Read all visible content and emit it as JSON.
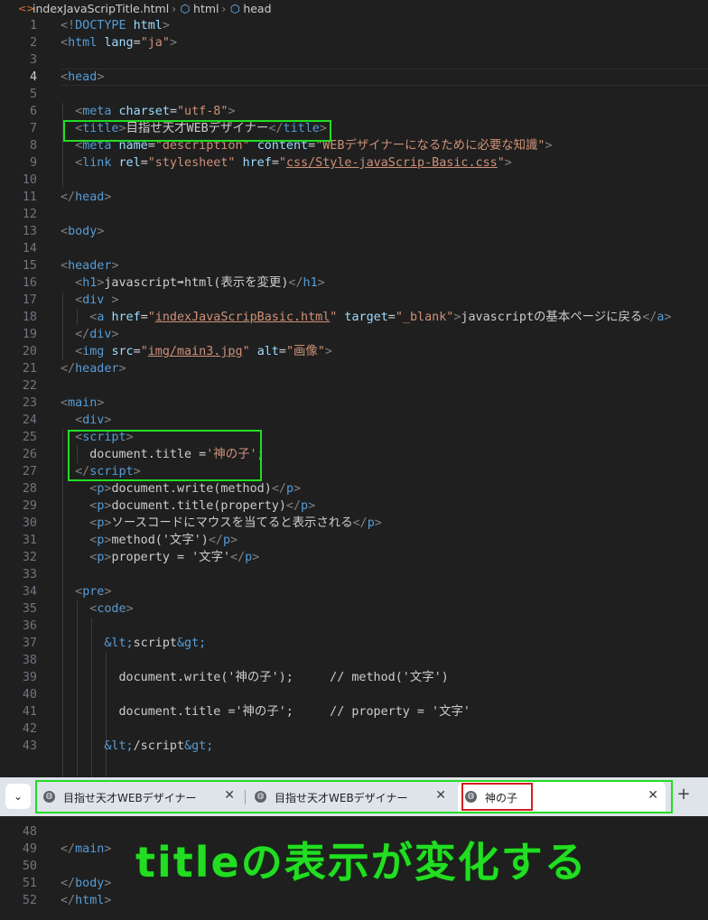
{
  "breadcrumb": {
    "items": [
      {
        "label": "indexJavaScripTitle.html",
        "icon": "html-file-icon"
      },
      {
        "label": "html",
        "icon": "element-cube-icon"
      },
      {
        "label": "head",
        "icon": "element-cube-icon"
      }
    ]
  },
  "editor": {
    "current_line": 4,
    "lines": [
      {
        "n": 1,
        "segs": [
          [
            "brk",
            "<!"
          ],
          [
            "tag",
            "DOCTYPE"
          ],
          [
            "txt",
            " "
          ],
          [
            "attr",
            "html"
          ],
          [
            "brk",
            ">"
          ]
        ]
      },
      {
        "n": 2,
        "segs": [
          [
            "brk",
            "<"
          ],
          [
            "tag",
            "html"
          ],
          [
            "txt",
            " "
          ],
          [
            "attr",
            "lang"
          ],
          [
            "txt",
            "="
          ],
          [
            "str",
            "\"ja\""
          ],
          [
            "brk",
            ">"
          ]
        ]
      },
      {
        "n": 3,
        "segs": []
      },
      {
        "n": 4,
        "segs": [
          [
            "brk",
            "<"
          ],
          [
            "tag",
            "head"
          ],
          [
            "brk",
            ">"
          ]
        ]
      },
      {
        "n": 5,
        "segs": []
      },
      {
        "n": 6,
        "segs": [
          [
            "txt",
            "  "
          ],
          [
            "brk",
            "<"
          ],
          [
            "tag",
            "meta"
          ],
          [
            "txt",
            " "
          ],
          [
            "attr",
            "charset"
          ],
          [
            "txt",
            "="
          ],
          [
            "str",
            "\"utf-8\""
          ],
          [
            "brk",
            ">"
          ]
        ]
      },
      {
        "n": 7,
        "segs": [
          [
            "txt",
            "  "
          ],
          [
            "brk",
            "<"
          ],
          [
            "tag",
            "title"
          ],
          [
            "brk",
            ">"
          ],
          [
            "txt",
            "目指せ天才WEBデザイナー"
          ],
          [
            "brk",
            "</"
          ],
          [
            "tag",
            "title"
          ],
          [
            "brk",
            ">"
          ]
        ]
      },
      {
        "n": 8,
        "segs": [
          [
            "txt",
            "  "
          ],
          [
            "brk",
            "<"
          ],
          [
            "tag",
            "meta"
          ],
          [
            "txt",
            " "
          ],
          [
            "attr",
            "name"
          ],
          [
            "txt",
            "="
          ],
          [
            "str",
            "\"description\""
          ],
          [
            "txt",
            " "
          ],
          [
            "attr",
            "content"
          ],
          [
            "txt",
            "="
          ],
          [
            "str",
            "\"WEBデザイナーになるために必要な知識\""
          ],
          [
            "brk",
            ">"
          ]
        ]
      },
      {
        "n": 9,
        "segs": [
          [
            "txt",
            "  "
          ],
          [
            "brk",
            "<"
          ],
          [
            "tag",
            "link"
          ],
          [
            "txt",
            " "
          ],
          [
            "attr",
            "rel"
          ],
          [
            "txt",
            "="
          ],
          [
            "str",
            "\"stylesheet\""
          ],
          [
            "txt",
            " "
          ],
          [
            "attr",
            "href"
          ],
          [
            "txt",
            "="
          ],
          [
            "str",
            "\""
          ],
          [
            "strul",
            "css/Style-javaScrip-Basic.css"
          ],
          [
            "str",
            "\""
          ],
          [
            "brk",
            ">"
          ]
        ]
      },
      {
        "n": 10,
        "segs": []
      },
      {
        "n": 11,
        "segs": [
          [
            "brk",
            "</"
          ],
          [
            "tag",
            "head"
          ],
          [
            "brk",
            ">"
          ]
        ]
      },
      {
        "n": 12,
        "segs": []
      },
      {
        "n": 13,
        "segs": [
          [
            "brk",
            "<"
          ],
          [
            "tag",
            "body"
          ],
          [
            "brk",
            ">"
          ]
        ]
      },
      {
        "n": 14,
        "segs": []
      },
      {
        "n": 15,
        "segs": [
          [
            "brk",
            "<"
          ],
          [
            "tag",
            "header"
          ],
          [
            "brk",
            ">"
          ]
        ]
      },
      {
        "n": 16,
        "segs": [
          [
            "txt",
            "  "
          ],
          [
            "brk",
            "<"
          ],
          [
            "tag",
            "h1"
          ],
          [
            "brk",
            ">"
          ],
          [
            "txt",
            "javascript➡html(表示を変更)"
          ],
          [
            "brk",
            "</"
          ],
          [
            "tag",
            "h1"
          ],
          [
            "brk",
            ">"
          ]
        ]
      },
      {
        "n": 17,
        "segs": [
          [
            "txt",
            "  "
          ],
          [
            "brk",
            "<"
          ],
          [
            "tag",
            "div"
          ],
          [
            "txt",
            " "
          ],
          [
            "brk",
            ">"
          ]
        ]
      },
      {
        "n": 18,
        "segs": [
          [
            "txt",
            "    "
          ],
          [
            "brk",
            "<"
          ],
          [
            "tag",
            "a"
          ],
          [
            "txt",
            " "
          ],
          [
            "attr",
            "href"
          ],
          [
            "txt",
            "="
          ],
          [
            "str",
            "\""
          ],
          [
            "strul",
            "indexJavaScripBasic.html"
          ],
          [
            "str",
            "\""
          ],
          [
            "txt",
            " "
          ],
          [
            "attr",
            "target"
          ],
          [
            "txt",
            "="
          ],
          [
            "str",
            "\"_blank\""
          ],
          [
            "brk",
            ">"
          ],
          [
            "txt",
            "javascriptの基本ページに戻る"
          ],
          [
            "brk",
            "</"
          ],
          [
            "tag",
            "a"
          ],
          [
            "brk",
            ">"
          ]
        ]
      },
      {
        "n": 19,
        "segs": [
          [
            "txt",
            "  "
          ],
          [
            "brk",
            "</"
          ],
          [
            "tag",
            "div"
          ],
          [
            "brk",
            ">"
          ]
        ]
      },
      {
        "n": 20,
        "segs": [
          [
            "txt",
            "  "
          ],
          [
            "brk",
            "<"
          ],
          [
            "tag",
            "img"
          ],
          [
            "txt",
            " "
          ],
          [
            "attr",
            "src"
          ],
          [
            "txt",
            "="
          ],
          [
            "str",
            "\""
          ],
          [
            "strul",
            "img/main3.jpg"
          ],
          [
            "str",
            "\""
          ],
          [
            "txt",
            " "
          ],
          [
            "attr",
            "alt"
          ],
          [
            "txt",
            "="
          ],
          [
            "str",
            "\"画像\""
          ],
          [
            "brk",
            ">"
          ]
        ]
      },
      {
        "n": 21,
        "segs": [
          [
            "brk",
            "</"
          ],
          [
            "tag",
            "header"
          ],
          [
            "brk",
            ">"
          ]
        ]
      },
      {
        "n": 22,
        "segs": []
      },
      {
        "n": 23,
        "segs": [
          [
            "brk",
            "<"
          ],
          [
            "tag",
            "main"
          ],
          [
            "brk",
            ">"
          ]
        ]
      },
      {
        "n": 24,
        "segs": [
          [
            "txt",
            "  "
          ],
          [
            "brk",
            "<"
          ],
          [
            "tag",
            "div"
          ],
          [
            "brk",
            ">"
          ]
        ]
      },
      {
        "n": 25,
        "segs": [
          [
            "txt",
            "  "
          ],
          [
            "brk",
            "<"
          ],
          [
            "tag",
            "script"
          ],
          [
            "brk",
            ">"
          ]
        ]
      },
      {
        "n": 26,
        "segs": [
          [
            "txt",
            "    document.title ="
          ],
          [
            "str",
            "'神の子'"
          ],
          [
            "txt",
            ";"
          ]
        ]
      },
      {
        "n": 27,
        "segs": [
          [
            "txt",
            "  "
          ],
          [
            "brk",
            "</"
          ],
          [
            "tag",
            "script"
          ],
          [
            "brk",
            ">"
          ]
        ]
      },
      {
        "n": 28,
        "segs": [
          [
            "txt",
            "    "
          ],
          [
            "brk",
            "<"
          ],
          [
            "tag",
            "p"
          ],
          [
            "brk",
            ">"
          ],
          [
            "txt",
            "document.write(method)"
          ],
          [
            "brk",
            "</"
          ],
          [
            "tag",
            "p"
          ],
          [
            "brk",
            ">"
          ]
        ]
      },
      {
        "n": 29,
        "segs": [
          [
            "txt",
            "    "
          ],
          [
            "brk",
            "<"
          ],
          [
            "tag",
            "p"
          ],
          [
            "brk",
            ">"
          ],
          [
            "txt",
            "document.title(property)"
          ],
          [
            "brk",
            "</"
          ],
          [
            "tag",
            "p"
          ],
          [
            "brk",
            ">"
          ]
        ]
      },
      {
        "n": 30,
        "segs": [
          [
            "txt",
            "    "
          ],
          [
            "brk",
            "<"
          ],
          [
            "tag",
            "p"
          ],
          [
            "brk",
            ">"
          ],
          [
            "txt",
            "ソースコードにマウスを当てると表示される"
          ],
          [
            "brk",
            "</"
          ],
          [
            "tag",
            "p"
          ],
          [
            "brk",
            ">"
          ]
        ]
      },
      {
        "n": 31,
        "segs": [
          [
            "txt",
            "    "
          ],
          [
            "brk",
            "<"
          ],
          [
            "tag",
            "p"
          ],
          [
            "brk",
            ">"
          ],
          [
            "txt",
            "method('文字')"
          ],
          [
            "brk",
            "</"
          ],
          [
            "tag",
            "p"
          ],
          [
            "brk",
            ">"
          ]
        ]
      },
      {
        "n": 32,
        "segs": [
          [
            "txt",
            "    "
          ],
          [
            "brk",
            "<"
          ],
          [
            "tag",
            "p"
          ],
          [
            "brk",
            ">"
          ],
          [
            "txt",
            "property = '文字'"
          ],
          [
            "brk",
            "</"
          ],
          [
            "tag",
            "p"
          ],
          [
            "brk",
            ">"
          ]
        ]
      },
      {
        "n": 33,
        "segs": []
      },
      {
        "n": 34,
        "segs": [
          [
            "txt",
            "  "
          ],
          [
            "brk",
            "<"
          ],
          [
            "tag",
            "pre"
          ],
          [
            "brk",
            ">"
          ]
        ]
      },
      {
        "n": 35,
        "segs": [
          [
            "txt",
            "    "
          ],
          [
            "brk",
            "<"
          ],
          [
            "tag",
            "code"
          ],
          [
            "brk",
            ">"
          ]
        ]
      },
      {
        "n": 36,
        "segs": []
      },
      {
        "n": 37,
        "segs": [
          [
            "txt",
            "      "
          ],
          [
            "tag",
            "&lt;"
          ],
          [
            "txt",
            "script"
          ],
          [
            "tag",
            "&gt;"
          ]
        ]
      },
      {
        "n": 38,
        "segs": []
      },
      {
        "n": 39,
        "segs": [
          [
            "txt",
            "        document.write('神の子');     // method('文字')"
          ]
        ]
      },
      {
        "n": 40,
        "segs": []
      },
      {
        "n": 41,
        "segs": [
          [
            "txt",
            "        document.title ='神の子';     // property = '文字'"
          ]
        ]
      },
      {
        "n": 42,
        "segs": []
      },
      {
        "n": 43,
        "segs": [
          [
            "txt",
            "      "
          ],
          [
            "tag",
            "&lt;"
          ],
          [
            "txt",
            "/script"
          ],
          [
            "tag",
            "&gt;"
          ]
        ]
      },
      {
        "n": 48,
        "segs": []
      },
      {
        "n": 49,
        "segs": [
          [
            "brk",
            "</"
          ],
          [
            "tag",
            "main"
          ],
          [
            "brk",
            ">"
          ]
        ]
      },
      {
        "n": 50,
        "segs": []
      },
      {
        "n": 51,
        "segs": [
          [
            "brk",
            "</"
          ],
          [
            "tag",
            "body"
          ],
          [
            "brk",
            ">"
          ]
        ]
      },
      {
        "n": 52,
        "segs": [
          [
            "brk",
            "</"
          ],
          [
            "tag",
            "html"
          ],
          [
            "brk",
            ">"
          ]
        ]
      }
    ]
  },
  "browser_tabs": {
    "dropdown_icon": "chevron-down-icon",
    "tabs": [
      {
        "label": "目指せ天才WEBデザイナー",
        "icon": "globe-icon",
        "close": "✕",
        "active": false
      },
      {
        "label": "目指せ天才WEBデザイナー",
        "icon": "globe-icon",
        "close": "✕",
        "active": false
      },
      {
        "label": "神の子",
        "icon": "globe-icon",
        "close": "✕",
        "active": true
      }
    ],
    "new_tab": "+"
  },
  "annotation": {
    "caption": "titleの表示が変化する",
    "highlight_color": "#22dd22",
    "emphasis_color": "#d42020"
  }
}
